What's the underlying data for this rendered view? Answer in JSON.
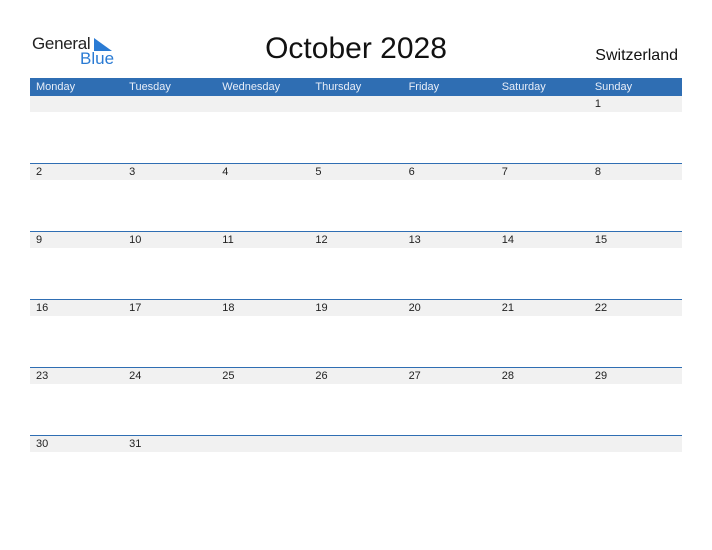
{
  "logo": {
    "general": "General",
    "blue": "Blue"
  },
  "title": "October 2028",
  "country": "Switzerland",
  "weekdays": [
    "Monday",
    "Tuesday",
    "Wednesday",
    "Thursday",
    "Friday",
    "Saturday",
    "Sunday"
  ],
  "weeks": [
    [
      "",
      "",
      "",
      "",
      "",
      "",
      "1"
    ],
    [
      "2",
      "3",
      "4",
      "5",
      "6",
      "7",
      "8"
    ],
    [
      "9",
      "10",
      "11",
      "12",
      "13",
      "14",
      "15"
    ],
    [
      "16",
      "17",
      "18",
      "19",
      "20",
      "21",
      "22"
    ],
    [
      "23",
      "24",
      "25",
      "26",
      "27",
      "28",
      "29"
    ],
    [
      "30",
      "31",
      "",
      "",
      "",
      "",
      ""
    ]
  ],
  "colors": {
    "accent": "#2f6eb3",
    "logo_blue": "#2a7bd4",
    "date_strip": "#f1f1f1"
  }
}
